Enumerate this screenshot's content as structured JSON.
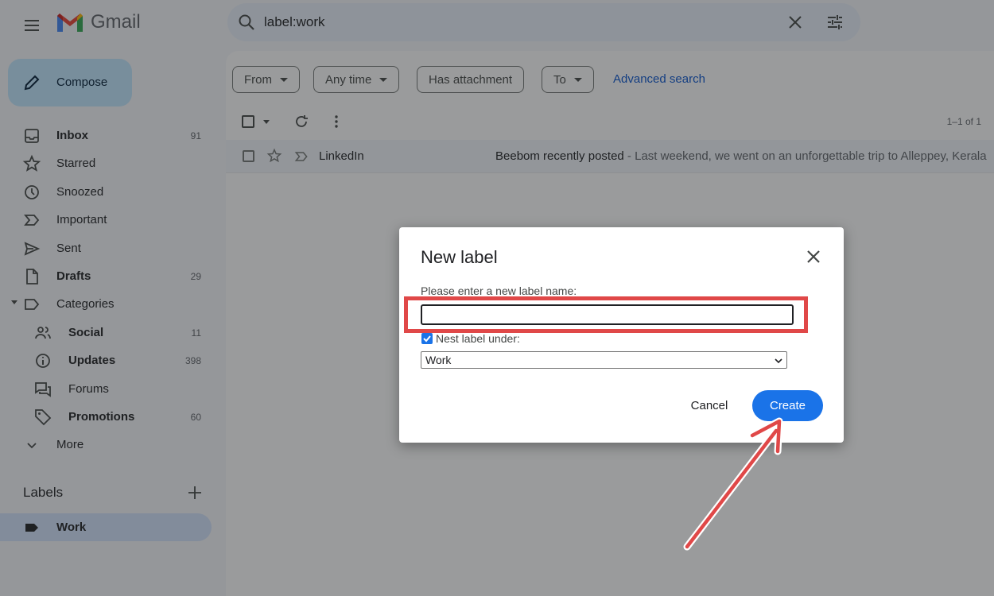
{
  "header": {
    "logo_text": "Gmail",
    "search_value": "label:work"
  },
  "sidebar": {
    "compose_label": "Compose",
    "items": [
      {
        "label": "Inbox",
        "count": "91",
        "bold": true,
        "icon": "inbox-icon"
      },
      {
        "label": "Starred",
        "count": "",
        "bold": false,
        "icon": "star-icon"
      },
      {
        "label": "Snoozed",
        "count": "",
        "bold": false,
        "icon": "clock-icon"
      },
      {
        "label": "Important",
        "count": "",
        "bold": false,
        "icon": "important-icon"
      },
      {
        "label": "Sent",
        "count": "",
        "bold": false,
        "icon": "send-icon"
      },
      {
        "label": "Drafts",
        "count": "29",
        "bold": true,
        "icon": "draft-icon"
      },
      {
        "label": "Categories",
        "count": "",
        "bold": false,
        "icon": "label-outline-icon"
      },
      {
        "label": "Social",
        "count": "11",
        "bold": true,
        "icon": "people-icon"
      },
      {
        "label": "Updates",
        "count": "398",
        "bold": true,
        "icon": "info-icon"
      },
      {
        "label": "Forums",
        "count": "",
        "bold": false,
        "icon": "forum-icon"
      },
      {
        "label": "Promotions",
        "count": "60",
        "bold": true,
        "icon": "tag-icon"
      },
      {
        "label": "More",
        "count": "",
        "bold": false,
        "icon": "chevron-down-icon"
      }
    ],
    "labels_heading": "Labels",
    "labels": [
      {
        "label": "Work",
        "icon": "label-filled-icon"
      }
    ]
  },
  "filters": {
    "chips": [
      "From",
      "Any time",
      "Has attachment",
      "To"
    ],
    "advanced_search": "Advanced search"
  },
  "toolbar": {
    "pagination": "1–1 of 1"
  },
  "emails": [
    {
      "sender": "LinkedIn",
      "subject": "Beebom recently posted",
      "snippet": " - Last weekend, we went on an unforgettable trip to Alleppey, Kerala"
    }
  ],
  "dialog": {
    "title": "New label",
    "prompt": "Please enter a new label name:",
    "input_value": "",
    "nest_label": "Nest label under:",
    "nest_checked": true,
    "nest_selected": "Work",
    "cancel_label": "Cancel",
    "create_label": "Create"
  },
  "colors": {
    "accent": "#1a73e8",
    "annotation": "#e04848",
    "compose_bg": "#c2e7ff"
  }
}
